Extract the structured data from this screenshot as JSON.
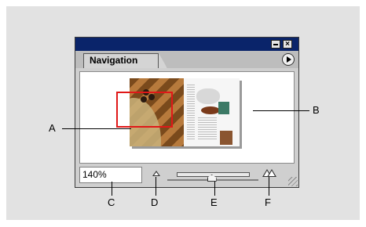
{
  "palette": {
    "tab_label": "Navigation",
    "zoom_value": "140%",
    "zoom_slider_fraction": 0.48
  },
  "callouts": {
    "a": "A",
    "b": "B",
    "c": "C",
    "d": "D",
    "e": "E",
    "f": "F"
  },
  "colors": {
    "titlebar": "#0a246a",
    "view_box": "#e01818"
  },
  "icons": [
    "minimize-icon",
    "close-icon",
    "palette-menu-icon",
    "zoom-out-icon",
    "zoom-slider-icon",
    "zoom-in-icon",
    "resize-grip-icon"
  ]
}
